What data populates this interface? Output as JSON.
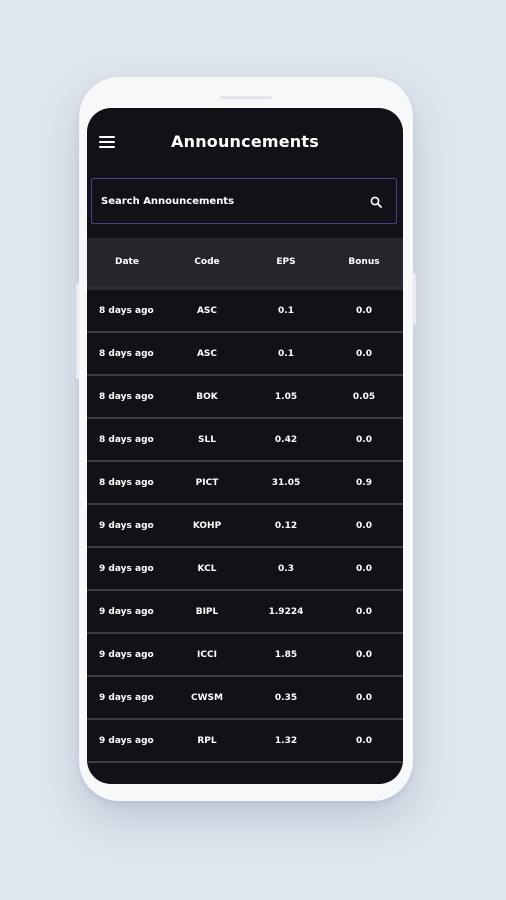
{
  "header": {
    "title": "Announcements"
  },
  "search": {
    "placeholder": "Search Announcements"
  },
  "table": {
    "columns": [
      "Date",
      "Code",
      "EPS",
      "Bonus"
    ],
    "rows": [
      {
        "date": "8 days ago",
        "code": "ASC",
        "eps": "0.1",
        "bonus": "0.0"
      },
      {
        "date": "8 days ago",
        "code": "ASC",
        "eps": "0.1",
        "bonus": "0.0"
      },
      {
        "date": "8 days ago",
        "code": "BOK",
        "eps": "1.05",
        "bonus": "0.05"
      },
      {
        "date": "8 days ago",
        "code": "SLL",
        "eps": "0.42",
        "bonus": "0.0"
      },
      {
        "date": "8 days ago",
        "code": "PICT",
        "eps": "31.05",
        "bonus": "0.9"
      },
      {
        "date": "9 days ago",
        "code": "KOHP",
        "eps": "0.12",
        "bonus": "0.0"
      },
      {
        "date": "9 days ago",
        "code": "KCL",
        "eps": "0.3",
        "bonus": "0.0"
      },
      {
        "date": "9 days ago",
        "code": "BIPL",
        "eps": "1.9224",
        "bonus": "0.0"
      },
      {
        "date": "9 days ago",
        "code": "ICCI",
        "eps": "1.85",
        "bonus": "0.0"
      },
      {
        "date": "9 days ago",
        "code": "CWSM",
        "eps": "0.35",
        "bonus": "0.0"
      },
      {
        "date": "9 days ago",
        "code": "RPL",
        "eps": "1.32",
        "bonus": "0.0"
      }
    ]
  },
  "colors": {
    "background": "#dfe6ee",
    "screen": "#111217",
    "header_row": "#24262c",
    "search_border": "#4f3f86",
    "text": "#ffffff"
  },
  "icons": {
    "menu": "hamburger-menu-icon",
    "search": "search-icon"
  }
}
